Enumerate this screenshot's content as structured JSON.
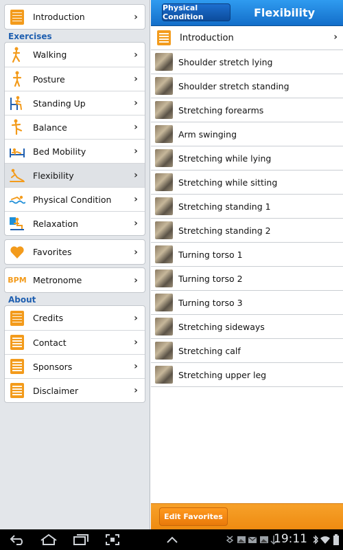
{
  "sidebar": {
    "introduction": "Introduction",
    "exercises_heading": "Exercises",
    "exercises": [
      {
        "label": "Walking",
        "icon": "walking-person-icon"
      },
      {
        "label": "Posture",
        "icon": "standing-person-icon"
      },
      {
        "label": "Standing Up",
        "icon": "chair-rise-icon"
      },
      {
        "label": "Balance",
        "icon": "balance-person-icon"
      },
      {
        "label": "Bed Mobility",
        "icon": "bed-icon"
      },
      {
        "label": "Flexibility",
        "icon": "stretch-person-icon"
      },
      {
        "label": "Physical Condition",
        "icon": "swimmer-icon"
      },
      {
        "label": "Relaxation",
        "icon": "relaxing-person-icon"
      }
    ],
    "selected": "Flexibility",
    "favorites": "Favorites",
    "metronome_badge": "BPM",
    "metronome": "Metronome",
    "about_heading": "About",
    "about": [
      "Credits",
      "Contact",
      "Sponsors",
      "Disclaimer"
    ]
  },
  "detail": {
    "back_label": "Physical Condition",
    "title": "Flexibility",
    "introduction": "Introduction",
    "items": [
      "Shoulder stretch lying",
      "Shoulder stretch standing",
      "Stretching forearms",
      "Arm swinging",
      "Stretching while lying",
      "Stretching while sitting",
      "Stretching standing 1",
      "Stretching standing 2",
      "Turning torso 1",
      "Turning torso 2",
      "Turning torso 3",
      "Stretching sideways",
      "Stretching calf",
      "Stretching upper leg"
    ],
    "edit_favorites": "Edit Favorites"
  },
  "system_bar": {
    "time": "19:11"
  },
  "colors": {
    "accent_orange": "#f39b1c",
    "header_blue": "#1a7fdc",
    "section_blue": "#1f5fb0"
  }
}
